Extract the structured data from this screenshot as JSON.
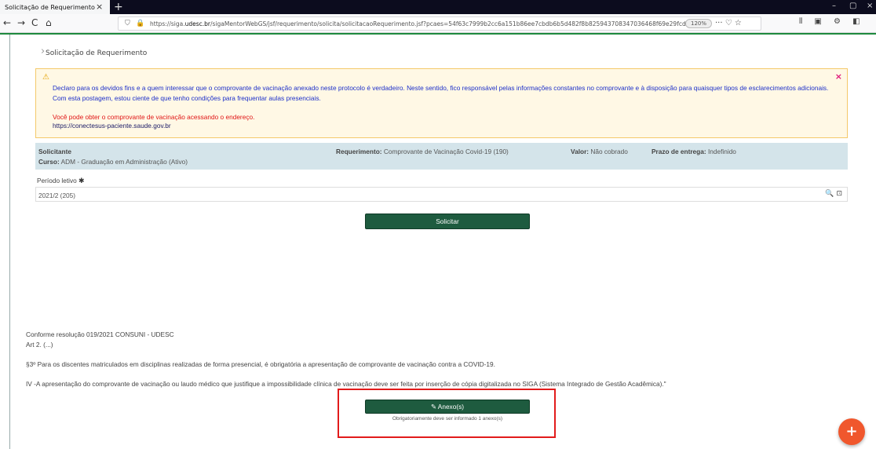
{
  "browser": {
    "tab_title": "Solicitação de Requerimento",
    "tab_close": "×",
    "new_tab": "+",
    "win_min": "–",
    "win_max": "▢",
    "win_close": "×",
    "back": "←",
    "forward": "→",
    "reload": "C",
    "home": "⌂",
    "url_prefix": "https://siga.",
    "url_domain": "udesc.br",
    "url_rest": "/sigaMentorWebGS/jsf/requerimento/solicita/solicitacaoRequerimento.jsf?pcaes=54f63c7999b2cc6a151b86ee7cbdb6b5d482f8b825943708347036468f69e29fcd739",
    "zoom": "120%",
    "url_actions": "··· ♡ ☆",
    "toolbar_icons": "⫴ ▣ ⚙ ◧",
    "accent_color": "#1e8a3e"
  },
  "page": {
    "breadcrumb": "Solicitação de Requerimento",
    "alert": {
      "icon": "⚠",
      "close": "×",
      "text": "Declaro para os devidos fins e a quem interessar que o comprovante de vacinação anexado neste protocolo é verdadeiro. Neste sentido, fico responsável pelas informações constantes no comprovante e à disposição para quaisquer tipos de esclarecimentos adicionais. Com esta postagem, estou ciente de que tenho condições para frequentar aulas presenciais.",
      "red_text": "Você pode obter o comprovante de vacinação acessando o endereço.",
      "link": "https://conectesus-paciente.saude.gov.br"
    },
    "info": {
      "solicitante_label": "Solicitante",
      "curso_label": "Curso:",
      "curso_value": "ADM - Graduação em Administração (Ativo)",
      "req_label": "Requerimento:",
      "req_value": "Comprovante de Vacinação Covid-19 (190)",
      "valor_label": "Valor:",
      "valor_value": "Não cobrado",
      "prazo_label": "Prazo de entrega:",
      "prazo_value": "Indefinido"
    },
    "period_label": "Período letivo",
    "period_required": "✱",
    "period_value": "2021/2 (205)",
    "period_icons": "🔍 ⊡",
    "solicitar_button": "Solicitar",
    "resolucao": {
      "line1": "Conforme resolução 019/2021 CONSUNI - UDESC",
      "line2": "Art 2. (...)",
      "line3": "§3º Para os discentes matriculados em disciplinas realizadas de forma presencial, é obrigatória a apresentação de comprovante de vacinação contra a COVID-19.",
      "line4": "IV -A apresentação do comprovante de vacinação ou laudo médico que justifique a impossibilidade clínica de vacinação deve ser feita por inserção de cópia digitalizada no SIGA (Sistema Integrado de Gestão Acadêmica).\""
    },
    "anexo_button": "✎ Anexo(s)",
    "anexo_hint": "Obrigatoriamente deve ser informado 1 anexo(s)",
    "fab": "+",
    "highlight_color": "#e21b1b"
  }
}
